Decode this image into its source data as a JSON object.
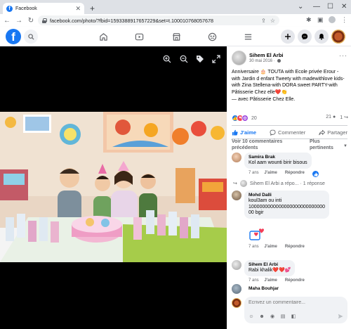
{
  "browser": {
    "tab_title": "Facebook",
    "tab_favicon": "f",
    "new_tab": "+",
    "url": "facebook.com/photo/?fbid=1593388917657229&set=t.100010768057678",
    "win_minimize": "—",
    "win_close": "✕"
  },
  "fb": {
    "logo": "f",
    "brand_color": "#1877f2"
  },
  "post": {
    "author": "Sihem El Arbi",
    "date": "30 mai 2016",
    "text": "Anniversaire 🎂 TOUTA with Ecole privée Erour - with Jardin d enfant Tweety with madewithlove kids-with Zina Stellena-with DORA sweet PARTY-with Pâtisserie Chez elle❤️👏",
    "tagline_prefix": "— avec ",
    "tagline_place": "Pâtisserie Chez Elle",
    "tagline_suffix": ".",
    "reaction_count": "20",
    "comment_count": "21",
    "share_count": "1"
  },
  "actions": {
    "like": "J'aime",
    "comment": "Commenter",
    "share": "Partager"
  },
  "comments_section": {
    "previous": "Voir 10 commentaires précédents",
    "sort": "Plus pertinents"
  },
  "comments": [
    {
      "name": "Samira Brak",
      "text": "Kol aam wounti birir bisous",
      "time": "7 ans",
      "like": "J'aime",
      "reply": "Répondre"
    },
    {
      "name": "Mohd Dalli",
      "text_1": "koul3am ou inti",
      "text_2": "1000000000000000000000000000",
      "text_3": "00 bgir",
      "time": "7 ans",
      "like": "J'aime",
      "reply": "Répondre"
    },
    {
      "name": "Sihem El Arbi",
      "text": "Rabi khalik❤️❤️💕",
      "time": "7 ans",
      "like": "J'aime",
      "reply": "Répondre"
    },
    {
      "name": "Maha Bouhjar"
    }
  ],
  "reply_preview": {
    "arrow": "↪",
    "text": "Sihem El Arbi a répo...",
    "separator": "·",
    "count": "1 réponse"
  },
  "compose": {
    "placeholder": "Écrivez un commentaire..."
  }
}
